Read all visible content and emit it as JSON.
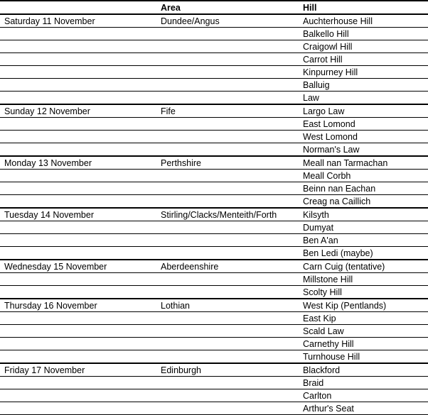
{
  "headers": {
    "date": "",
    "area": "Area",
    "hill": "Hill"
  },
  "groups": [
    {
      "date": "Saturday 11 November",
      "area": "Dundee/Angus",
      "hills": [
        "Auchterhouse Hill",
        "Balkello Hill",
        "Craigowl Hill",
        "Carrot Hill",
        "Kinpurney Hill",
        "Balluig",
        "Law"
      ]
    },
    {
      "date": "Sunday 12 November",
      "area": "Fife",
      "hills": [
        "Largo Law",
        "East Lomond",
        "West Lomond",
        "Norman's Law"
      ]
    },
    {
      "date": "Monday 13 November",
      "area": "Perthshire",
      "hills": [
        "Meall nan Tarmachan",
        "Meall Corbh",
        "Beinn nan Eachan",
        "Creag na Caillich"
      ]
    },
    {
      "date": "Tuesday 14 November",
      "area": "Stirling/Clacks/Menteith/Forth",
      "hills": [
        "Kilsyth",
        "Dumyat",
        "Ben A'an",
        "Ben Ledi (maybe)"
      ]
    },
    {
      "date": "Wednesday 15 November",
      "area": "Aberdeenshire",
      "hills": [
        "Carn Cuig (tentative)",
        "Millstone Hill",
        "Scolty Hill"
      ]
    },
    {
      "date": "Thursday 16 November",
      "area": "Lothian",
      "hills": [
        "West Kip (Pentlands)",
        "East Kip",
        "Scald Law",
        "Carnethy Hill",
        "Turnhouse Hill"
      ]
    },
    {
      "date": "Friday 17 November",
      "area": "Edinburgh",
      "hills": [
        "Blackford",
        "Braid",
        "Carlton",
        "Arthur's Seat"
      ]
    }
  ]
}
